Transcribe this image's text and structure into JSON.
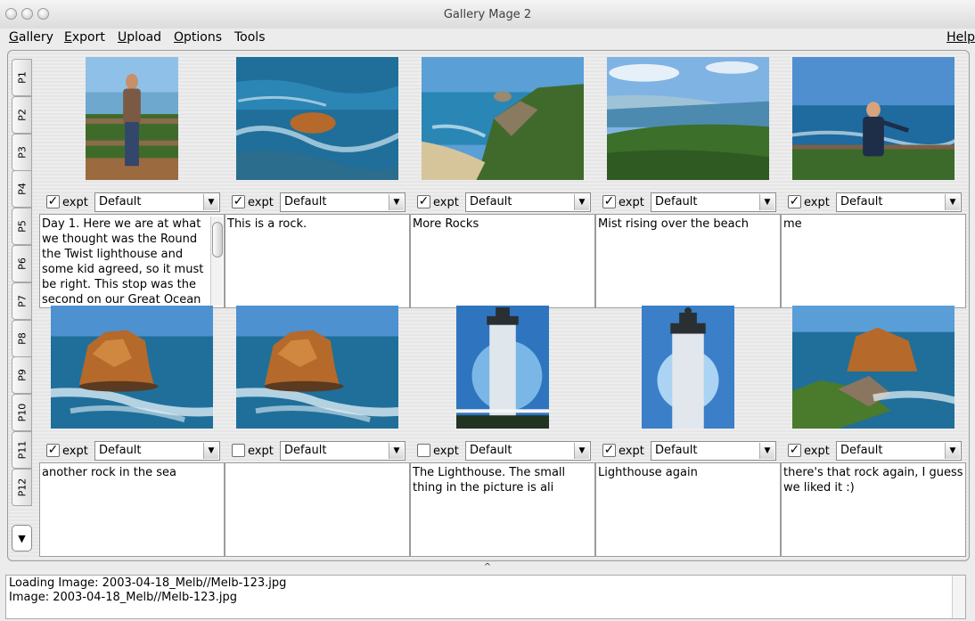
{
  "window": {
    "title": "Gallery Mage 2"
  },
  "menu": [
    {
      "label": "Gallery",
      "u": "G"
    },
    {
      "label": "Export",
      "u": "E"
    },
    {
      "label": "Upload",
      "u": "U"
    },
    {
      "label": "Options",
      "u": "O"
    },
    {
      "label": "Tools",
      "u": ""
    }
  ],
  "help": "Help",
  "pages": [
    "P1",
    "P2",
    "P3",
    "P4",
    "P5",
    "P6",
    "P7",
    "P8",
    "P9",
    "P10",
    "P11",
    "P12"
  ],
  "page_scroll_icon": "chevron-down-icon",
  "photos": [
    {
      "export": true,
      "label": "expt",
      "option": "Default",
      "caption": "Day 1.  Here we are at what we thought was the Round the Twist lighthouse and some kid agreed, so it must be right.  This stop was the second on our Great Ocean",
      "scene": "person-fence"
    },
    {
      "export": true,
      "label": "expt",
      "option": "Default",
      "caption": "This is a rock.",
      "scene": "sea-rock"
    },
    {
      "export": true,
      "label": "expt",
      "option": "Default",
      "caption": "More Rocks",
      "scene": "cliff-beach"
    },
    {
      "export": true,
      "label": "expt",
      "option": "Default",
      "caption": "Mist rising over the beach",
      "scene": "misty-coast"
    },
    {
      "export": true,
      "label": "expt",
      "option": "Default",
      "caption": "me",
      "scene": "person-ocean"
    },
    {
      "export": true,
      "label": "expt",
      "option": "Default",
      "caption": "another rock in the sea",
      "scene": "stack-rock"
    },
    {
      "export": false,
      "label": "expt",
      "option": "Default",
      "caption": "",
      "scene": "stack-rock"
    },
    {
      "export": false,
      "label": "expt",
      "option": "Default",
      "caption": "The Lighthouse.  The small thing in the picture is ali",
      "scene": "lighthouse"
    },
    {
      "export": true,
      "label": "expt",
      "option": "Default",
      "caption": "Lighthouse again",
      "scene": "lighthouse2"
    },
    {
      "export": true,
      "label": "expt",
      "option": "Default",
      "caption": "there's that rock again, I guess we liked it :)",
      "scene": "rock-green"
    }
  ],
  "splitter": "^",
  "log": [
    "Loading Image: 2003-04-18_Melb//Melb-123.jpg",
    "Image: 2003-04-18_Melb//Melb-123.jpg"
  ],
  "colors": {
    "sea": "#1f6f9a",
    "sky": "#5a9fd6",
    "rock": "#b5692a",
    "grass": "#4a7a2c"
  }
}
